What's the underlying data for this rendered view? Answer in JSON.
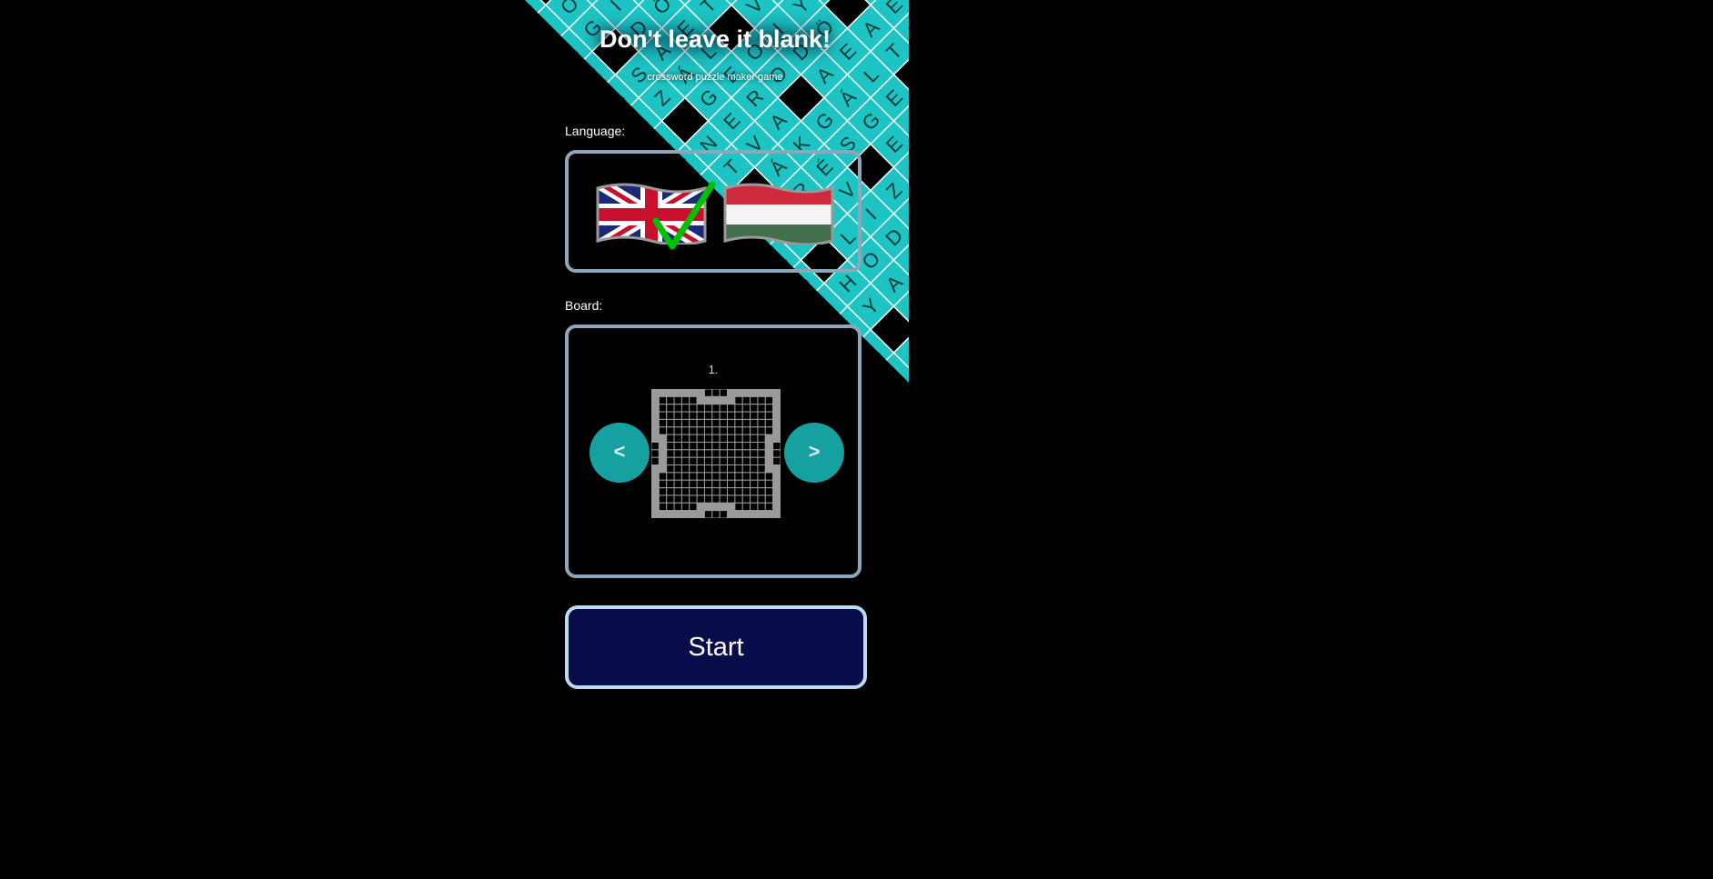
{
  "header": {
    "title": "Don't leave it blank!",
    "subtitle": "crossword puzzle maker game"
  },
  "language": {
    "label": "Language:",
    "options": [
      {
        "name": "English",
        "flag": "uk-flag-icon",
        "selected": true
      },
      {
        "name": "Hungarian",
        "flag": "hungary-flag-icon",
        "selected": false
      }
    ]
  },
  "board": {
    "label": "Board:",
    "number": "1.",
    "prev_label": "<",
    "next_label": ">"
  },
  "start_label": "Start",
  "background_letters": [
    "E",
    "L",
    "E",
    "R",
    "A",
    "K",
    "É",
    "V",
    "I",
    "D",
    "A",
    "Á",
    "G",
    "E",
    "V",
    "Á",
    "R",
    "T",
    "L",
    "O",
    "A",
    "T",
    "Ó",
    "O",
    "G",
    "S",
    "Z",
    "N",
    "T",
    "Ö",
    "Ü",
    "H",
    "Y",
    "Ö"
  ],
  "colors": {
    "background": "#000000",
    "tile": "#1ec3c4",
    "nav_button": "#16a09f",
    "start_button": "#090b4b",
    "border": "#8fa6b8",
    "checkmark": "#00c000"
  }
}
